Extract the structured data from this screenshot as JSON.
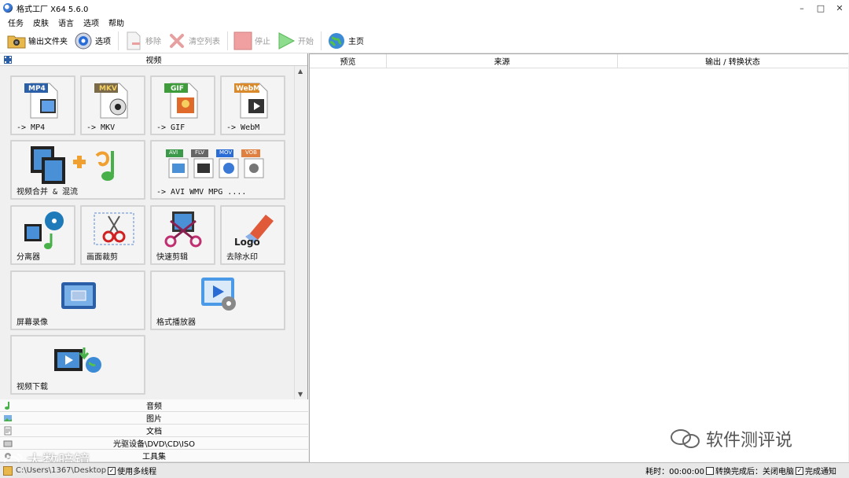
{
  "window": {
    "title": "格式工厂 X64 5.6.0"
  },
  "menu": [
    "任务",
    "皮肤",
    "语言",
    "选项",
    "帮助"
  ],
  "toolbar": {
    "output_folder": "输出文件夹",
    "options": "选项",
    "remove": "移除",
    "clear_list": "清空列表",
    "stop": "停止",
    "start": "开始",
    "home": "主页"
  },
  "sections": {
    "video": "视频",
    "audio": "音频",
    "image": "图片",
    "document": "文档",
    "disc": "光驱设备\\DVD\\CD\\ISO",
    "tools": "工具集"
  },
  "video_tiles": {
    "mp4": {
      "badge": "MP4",
      "label": "-> MP4"
    },
    "mkv": {
      "badge": "MKV",
      "label": "-> MKV"
    },
    "gif": {
      "badge": "GIF",
      "label": "-> GIF"
    },
    "webm": {
      "badge": "WebM",
      "label": "-> WebM"
    },
    "merge": {
      "label": "视频合并 & 混流"
    },
    "avi_etc": {
      "badges": [
        "AVI",
        "FLV",
        "MOV",
        "VOB"
      ],
      "label": "-> AVI WMV MPG ...."
    },
    "separate": {
      "label": "分离器"
    },
    "crop": {
      "label": "画面裁剪"
    },
    "quick_cut": {
      "label": "快速剪辑"
    },
    "remove_logo": {
      "label": "去除水印",
      "logo_text": "Logo"
    },
    "screen_record": {
      "label": "屏幕录像"
    },
    "player": {
      "label": "格式播放器"
    },
    "download": {
      "label": "视频下载"
    }
  },
  "task_columns": [
    "预览",
    "来源",
    "输出 / 转换状态"
  ],
  "status": {
    "path": "C:\\Users\\1367\\Desktop",
    "multithread": "使用多线程",
    "elapsed": "耗时：00:00:00",
    "after_done": "转换完成后：关闭电脑",
    "notify": "完成通知"
  },
  "watermarks": {
    "wechat": "软件测评说",
    "weibo": "大数暗镜"
  },
  "colors": {
    "accent": "#2a6cd6",
    "mp4": "#2b5fa8",
    "mkv": "#7a6a4a",
    "gif": "#3f9c3a",
    "webm": "#d98a2c",
    "start": "#45c045",
    "stop": "#e07070"
  }
}
